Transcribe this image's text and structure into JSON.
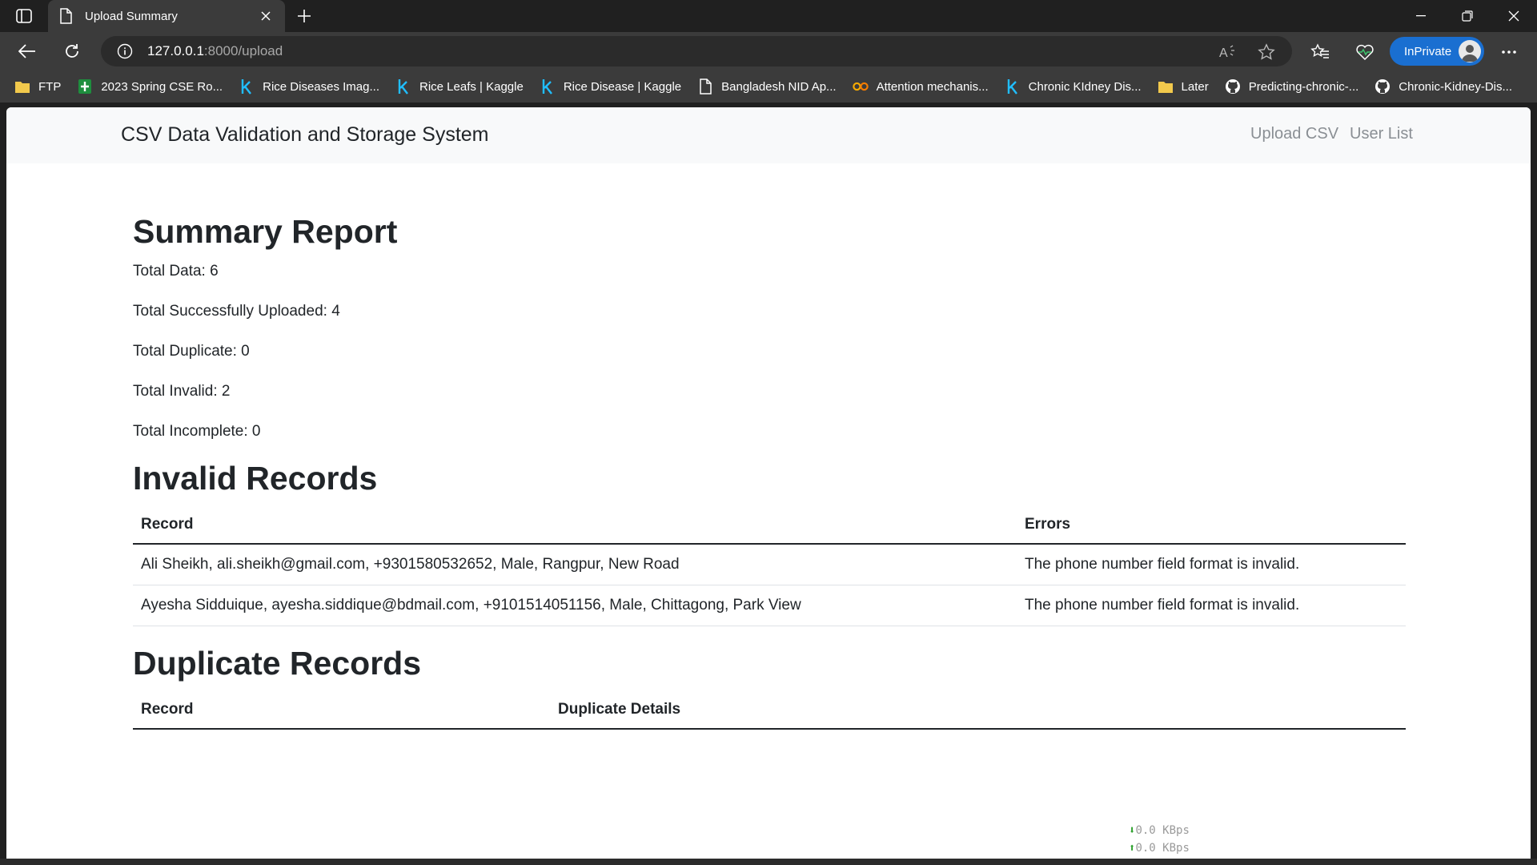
{
  "browser": {
    "tab_title": "Upload Summary",
    "url_host": "127.0.0.1",
    "url_path": ":8000/upload",
    "inprivate_label": "InPrivate"
  },
  "bookmarks": [
    {
      "label": "FTP",
      "icon": "folder-icon"
    },
    {
      "label": "2023 Spring CSE Ro...",
      "icon": "sheets-icon"
    },
    {
      "label": "Rice Diseases Imag...",
      "icon": "kaggle-icon"
    },
    {
      "label": "Rice Leafs | Kaggle",
      "icon": "kaggle-icon"
    },
    {
      "label": "Rice Disease | Kaggle",
      "icon": "kaggle-icon"
    },
    {
      "label": "Bangladesh NID Ap...",
      "icon": "document-icon"
    },
    {
      "label": "Attention mechanis...",
      "icon": "colab-icon"
    },
    {
      "label": "Chronic KIdney Dis...",
      "icon": "kaggle-icon"
    },
    {
      "label": "Later",
      "icon": "folder-icon"
    },
    {
      "label": "Predicting-chronic-...",
      "icon": "github-icon"
    },
    {
      "label": "Chronic-Kidney-Dis...",
      "icon": "github-icon"
    }
  ],
  "site": {
    "brand": "CSV Data Validation and Storage System",
    "nav": [
      "Upload CSV",
      "User List"
    ]
  },
  "summary": {
    "heading": "Summary Report",
    "stats": [
      "Total Data: 6",
      "Total Successfully Uploaded: 4",
      "Total Duplicate: 0",
      "Total Invalid: 2",
      "Total Incomplete: 0"
    ]
  },
  "invalid": {
    "heading": "Invalid Records",
    "columns": [
      "Record",
      "Errors"
    ],
    "rows": [
      [
        "Ali Sheikh, ali.sheikh@gmail.com, +9301580532652, Male, Rangpur, New Road",
        "The phone number field format is invalid."
      ],
      [
        "Ayesha Sidduique, ayesha.siddique@bdmail.com, +9101514051156, Male, Chittagong, Park View",
        "The phone number field format is invalid."
      ]
    ]
  },
  "duplicate": {
    "heading": "Duplicate Records",
    "columns": [
      "Record",
      "Duplicate Details"
    ],
    "rows": []
  },
  "netmon": {
    "down": "0.0 KBps",
    "up": "0.0 KBps"
  },
  "colors": {
    "accent": "#1a6fd1",
    "chrome": "#3b3b3b",
    "navbar_bg": "#f8f9fa"
  }
}
